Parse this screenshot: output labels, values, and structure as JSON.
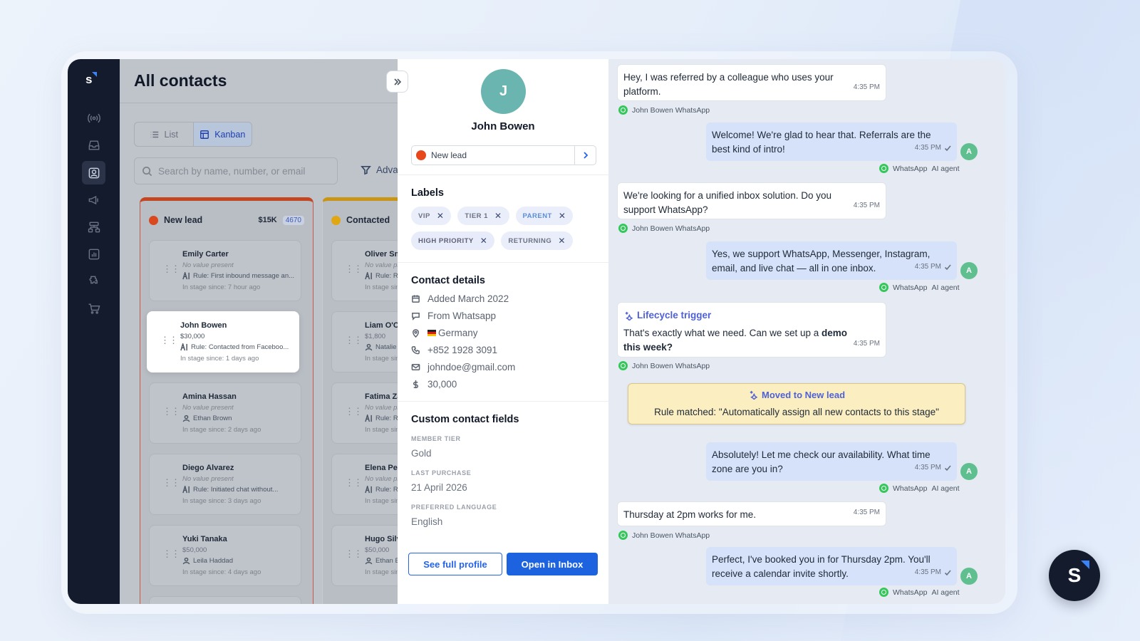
{
  "nav": {
    "logo": "s"
  },
  "contacts": {
    "title": "All contacts",
    "view_list": "List",
    "view_kanban": "Kanban",
    "search_placeholder": "Search by name, number, or email",
    "advanced": "Advanced filters",
    "columns": [
      {
        "name": "New lead",
        "color": "#d9481f",
        "amount": "$15K",
        "count": "4670",
        "cards": [
          {
            "name": "Emily Carter",
            "value": "No value present",
            "meta": "Rule: First inbound message an...",
            "stage": "In stage since: 7 hour ago",
            "meta_icon": "ai-icon"
          },
          {
            "name": "John Bowen",
            "value": "$30,000",
            "meta": "Rule: Contacted from Faceboo...",
            "stage": "In stage since: 1 days ago",
            "meta_icon": "ai-icon"
          },
          {
            "name": "Amina Hassan",
            "value": "No value present",
            "meta": "Ethan Brown",
            "stage": "In stage since: 2 days ago",
            "meta_icon": "user-icon"
          },
          {
            "name": "Diego Alvarez",
            "value": "No value present",
            "meta": "Rule: Initiated chat without...",
            "stage": "In stage since: 3 days ago",
            "meta_icon": "ai-icon"
          },
          {
            "name": "Yuki Tanaka",
            "value": "$50,000",
            "meta": "Leila Haddad",
            "stage": "In stage since: 4 days ago",
            "meta_icon": "user-icon"
          }
        ]
      },
      {
        "name": "Contacted",
        "color": "#e0a712",
        "cards": [
          {
            "name": "Oliver Smith",
            "value": "No value present",
            "meta": "Rule: Re",
            "stage": "In stage since"
          },
          {
            "name": "Liam O'Connor",
            "value": "$1,800",
            "meta": "Natalie",
            "stage": "In stage since"
          },
          {
            "name": "Fatima Zahra",
            "value": "No value present",
            "meta": "Rule: Re",
            "stage": "In stage since"
          },
          {
            "name": "Elena Petrova",
            "value": "No value present",
            "meta": "Rule: Re",
            "stage": "In stage since"
          },
          {
            "name": "Hugo Silva",
            "value": "$50,000",
            "meta": "Ethan Br",
            "stage": "In stage since"
          }
        ]
      }
    ]
  },
  "detail": {
    "initial": "J",
    "name": "John Bowen",
    "stage": "New lead",
    "labels_title": "Labels",
    "labels": [
      "VIP",
      "TIER 1",
      "PARENT",
      "HIGH PRIORITY",
      "RETURNING"
    ],
    "contact_title": "Contact details",
    "added": "Added March 2022",
    "source": "From Whatsapp",
    "country": "Germany",
    "phone": "+852 1928 3091",
    "email": "johndoe@gmail.com",
    "value": "30,000",
    "custom_title": "Custom contact fields",
    "custom": [
      {
        "label": "MEMBER TIER",
        "value": "Gold"
      },
      {
        "label": "LAST PURCHASE",
        "value": "21 April 2026"
      },
      {
        "label": "PREFERRED LANGUAGE",
        "value": "English"
      }
    ],
    "see_profile": "See full profile",
    "open_inbox": "Open in Inbox"
  },
  "chat": {
    "m1": "Hey, I was referred by a colleague who uses your platform.",
    "m2": "Welcome! We're glad to hear that. Referrals are the best kind of intro!",
    "m3": "We're looking for a unified inbox solution. Do you support WhatsApp?",
    "m4": "Yes, we support WhatsApp, Messenger, Instagram, email, and live chat — all in one inbox.",
    "trigger": "Lifecycle trigger",
    "m5a": "That's exactly what we need. Can we set up a ",
    "m5b": "demo this week?",
    "moved_title": "Moved to New lead",
    "moved_rule": "Rule matched: \"Automatically assign all new contacts to this stage\"",
    "m6": "Absolutely! Let me check our availability. What time zone are you in?",
    "m7": "Thursday at 2pm works for me.",
    "m8": "Perfect, I've booked you in for Thursday 2pm. You'll receive a calendar invite shortly.",
    "time": "4:35 PM",
    "via_contact": "John Bowen WhatsApp",
    "via_whatsapp": "WhatsApp",
    "via_agent": "AI agent",
    "agent_initial": "A"
  },
  "fab": "S"
}
